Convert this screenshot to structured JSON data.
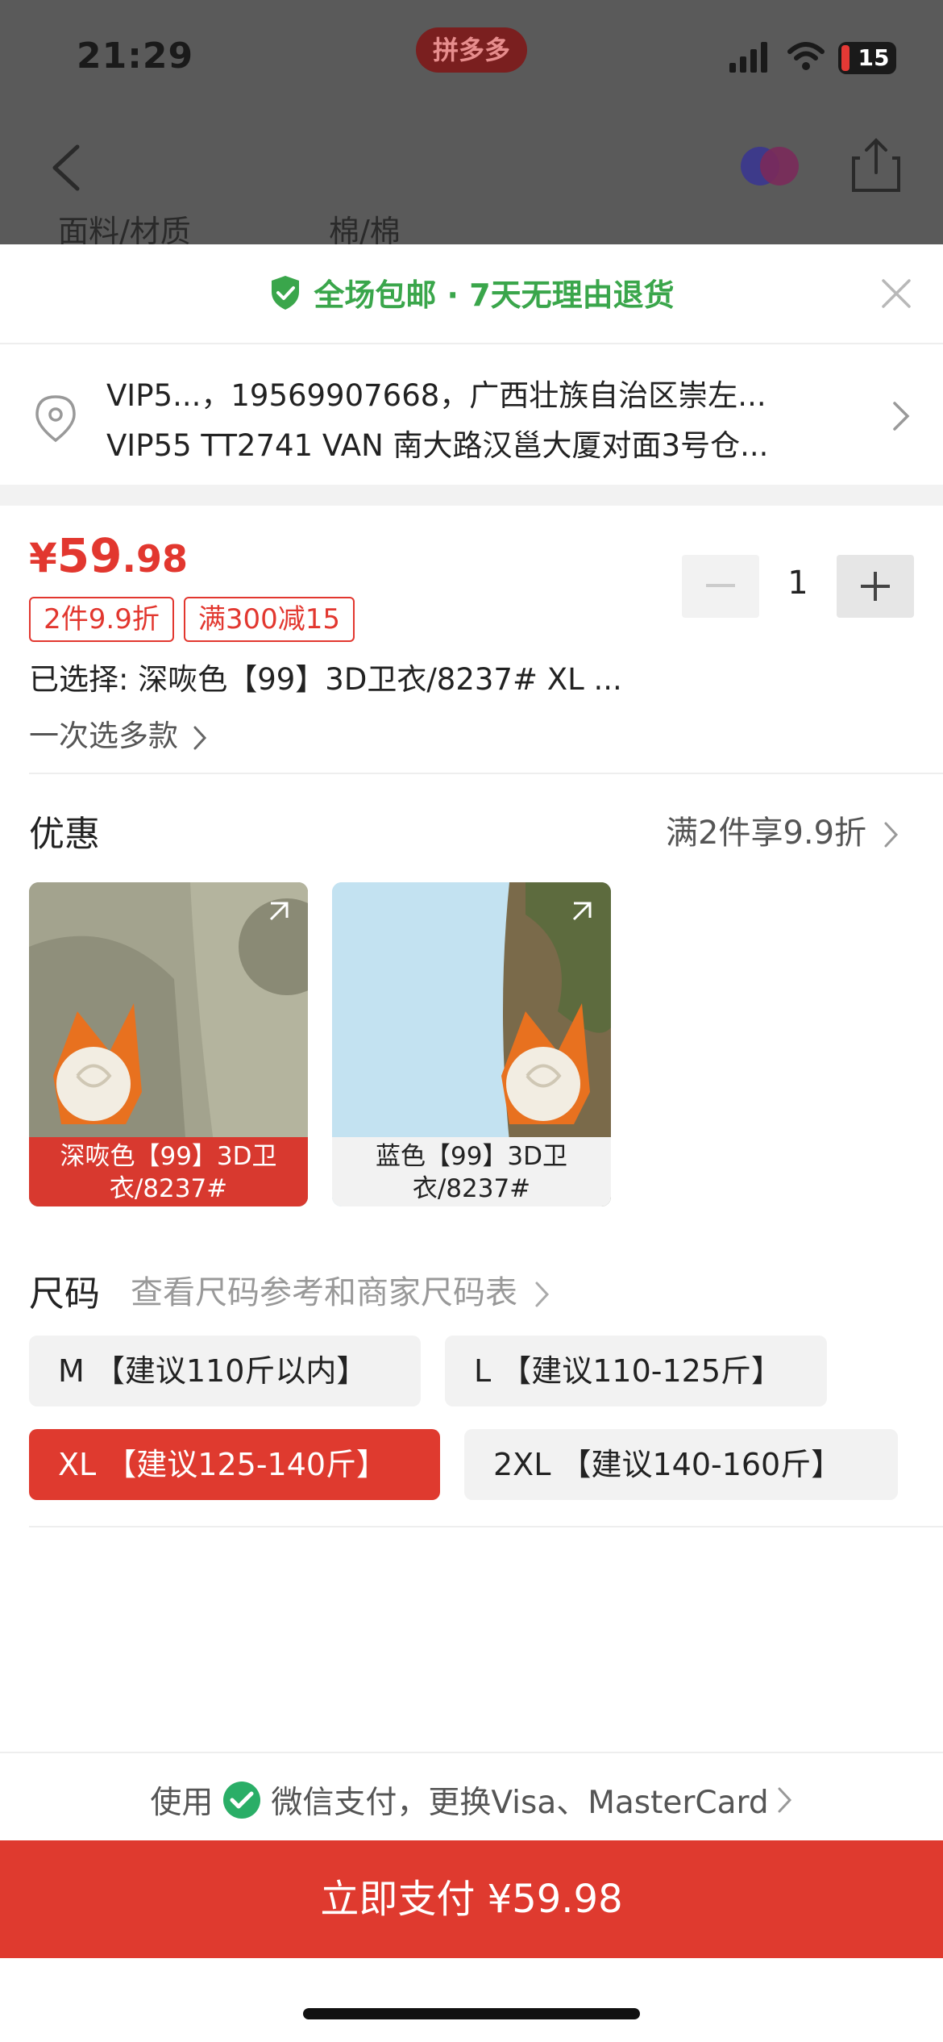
{
  "status_bar": {
    "time": "21:29",
    "app_badge": "拼多多",
    "battery": "15"
  },
  "peek": {
    "left": "面料/材质",
    "right": "棉/棉"
  },
  "banner": {
    "text": "全场包邮 · 7天无理由退货"
  },
  "address": {
    "line1": "VIP5...，19569907668，广西壮族自治区崇左...",
    "line2": "VIP55 TT2741 VAN  南大路汉邕大厦对面3号仓..."
  },
  "product": {
    "price_symbol": "¥",
    "price_int": "59",
    "price_dec": ".98",
    "tags": [
      "2件9.9折",
      "满300减15"
    ],
    "selected": "已选择: 深咴色【99】3D卫衣/8237# XL ...",
    "multi_select": "一次选多款",
    "stepper": {
      "minus": "−",
      "qty": "1",
      "plus": "+"
    }
  },
  "promo": {
    "title": "优惠",
    "right": "满2件享9.9折",
    "options": [
      {
        "label": "深咴色【99】3D卫衣/8237#",
        "selected": true
      },
      {
        "label": "蓝色【99】3D卫衣/8237#",
        "selected": false
      }
    ]
  },
  "size": {
    "title": "尺码",
    "link": "查看尺码参考和商家尺码表",
    "options": [
      {
        "label": "M 【建议110斤以内】",
        "selected": false
      },
      {
        "label": "L 【建议110-125斤】",
        "selected": false
      },
      {
        "label": "XL 【建议125-140斤】",
        "selected": true
      },
      {
        "label": "2XL 【建议140-160斤】",
        "selected": false
      }
    ]
  },
  "payment": {
    "prefix": "使用",
    "method": "微信支付，更换Visa、MasterCard",
    "button": "立即支付 ¥59.98"
  },
  "colors": {
    "accent": "#df3a2f",
    "green": "#3aa64b",
    "wechat": "#2aae67"
  }
}
